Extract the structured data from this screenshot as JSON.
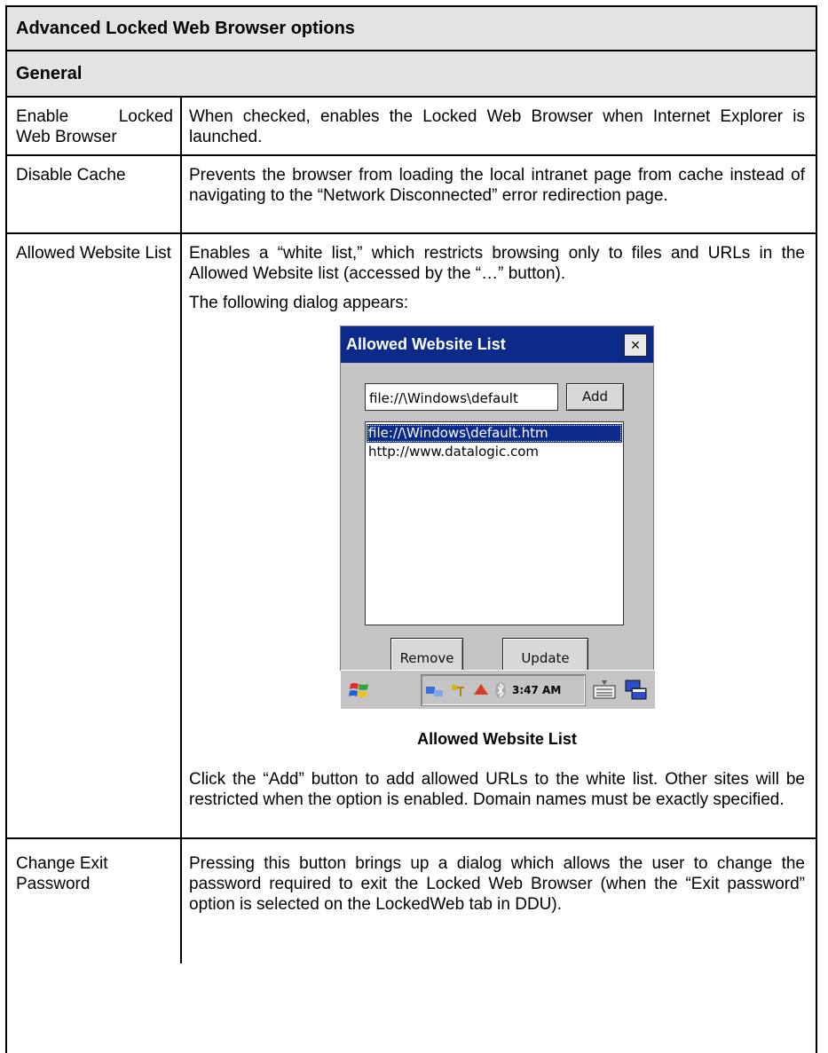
{
  "title": "Advanced Locked Web Browser options",
  "section": "General",
  "rows": [
    {
      "label_a": "Enable",
      "label_b": "Locked",
      "label_c": "Web Browser",
      "desc": "When checked, enables the Locked Web Browser when Internet Explorer is launched."
    },
    {
      "label": "Disable Cache",
      "desc": "Prevents the browser from loading the local intranet page from cache instead of navigating to the “Network Disconnected” error redirection page."
    },
    {
      "label": "Allowed Website List",
      "desc1": "Enables a “white list,” which restricts browsing only to files and URLs in the Allowed Website list (accessed by the “…” button).",
      "desc2": "The following dialog appears:",
      "desc3": "Click the “Add” button to add allowed URLs to the white list. Other sites will be restricted when the option is enabled. Domain names must be exactly specified."
    },
    {
      "label": "Change Exit Password",
      "desc": "Pressing this button brings up a dialog which allows the user to change the password required to exit the Locked Web Browser (when the “Exit password” option is selected on the LockedWeb tab in DDU)."
    }
  ],
  "dialog": {
    "title": "Allowed Website List",
    "close": "×",
    "url_value": "file://\\Windows\\default",
    "add_label": "Add",
    "list_items": [
      "file://\\Windows\\default.htm",
      "http://www.datalogic.com"
    ],
    "remove_label": "Remove",
    "update_label": "Update",
    "time": "3:47 AM"
  },
  "caption": "Allowed Website List",
  "colors": {
    "title_bar": "#0b2a8a",
    "dialog_bg": "#c4c4c4",
    "header_bg": "#e3e3e3"
  }
}
